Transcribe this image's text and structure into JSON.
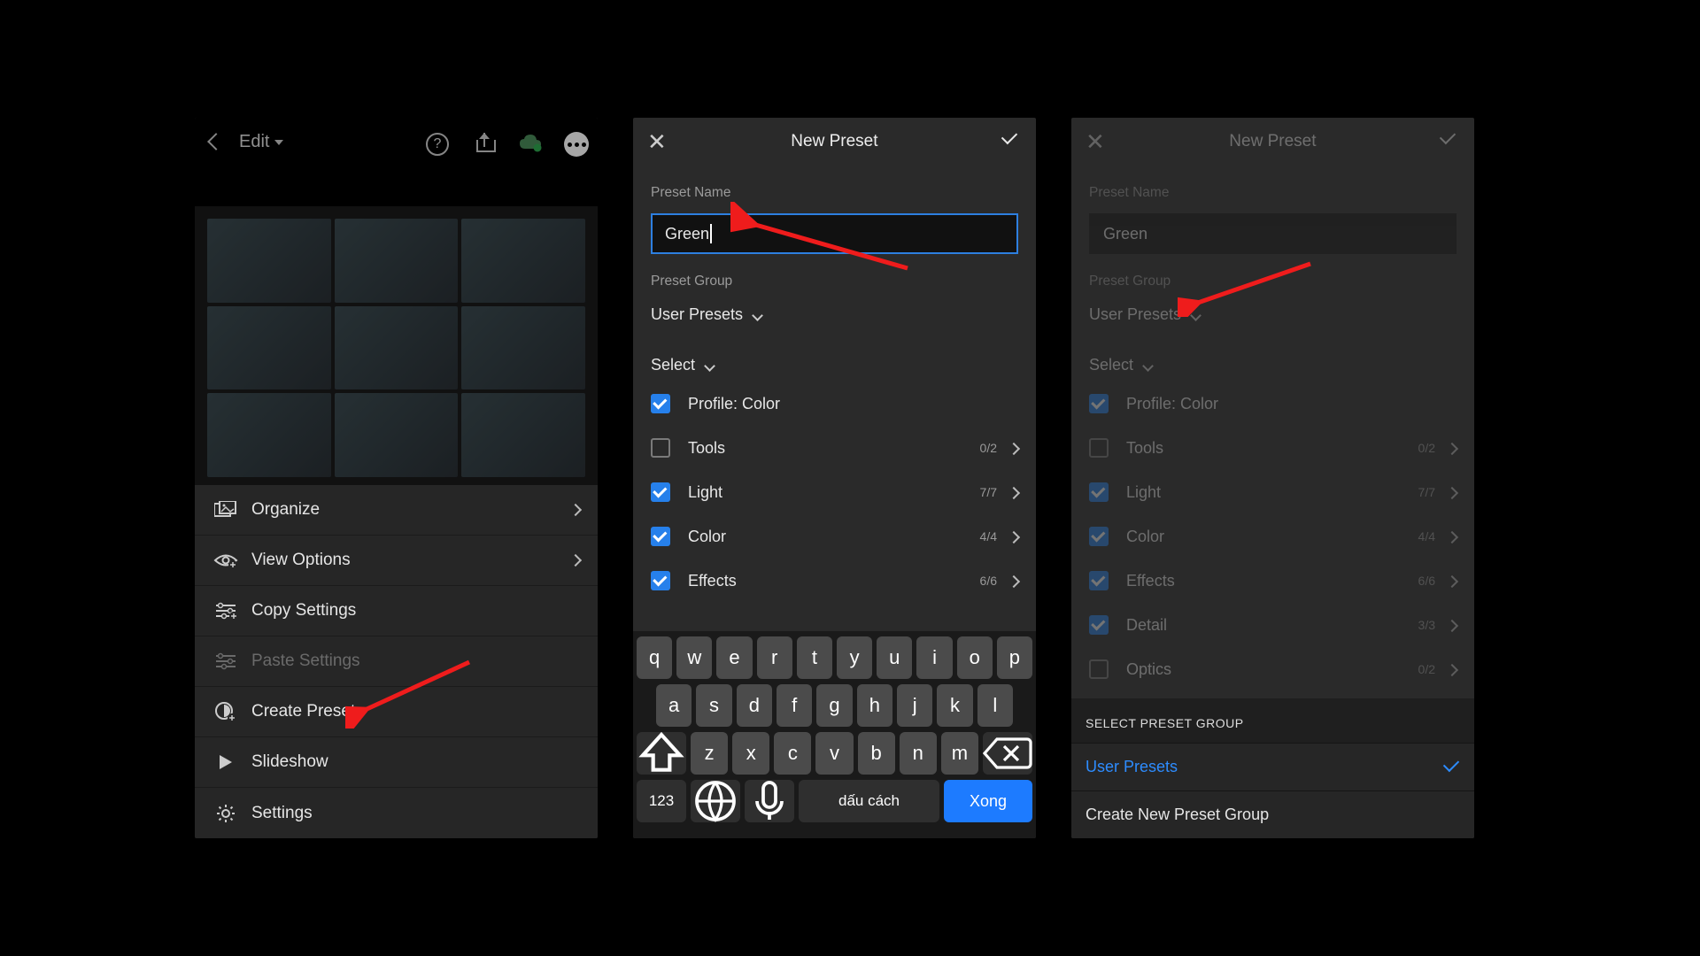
{
  "panel1": {
    "title": "Edit",
    "menu": {
      "organize": "Organize",
      "view_options": "View Options",
      "copy_settings": "Copy Settings",
      "paste_settings": "Paste Settings",
      "create_preset": "Create Preset",
      "slideshow": "Slideshow",
      "settings": "Settings"
    }
  },
  "panel2": {
    "title": "New Preset",
    "preset_name_label": "Preset Name",
    "preset_name_value": "Green",
    "preset_group_label": "Preset Group",
    "preset_group_value": "User Presets",
    "select_label": "Select",
    "options": [
      {
        "label": "Profile: Color",
        "checked": true,
        "count": ""
      },
      {
        "label": "Tools",
        "checked": false,
        "count": "0/2"
      },
      {
        "label": "Light",
        "checked": true,
        "count": "7/7"
      },
      {
        "label": "Color",
        "checked": true,
        "count": "4/4"
      },
      {
        "label": "Effects",
        "checked": true,
        "count": "6/6"
      }
    ],
    "keyboard": {
      "row1": [
        "q",
        "w",
        "e",
        "r",
        "t",
        "y",
        "u",
        "i",
        "o",
        "p"
      ],
      "row2": [
        "a",
        "s",
        "d",
        "f",
        "g",
        "h",
        "j",
        "k",
        "l"
      ],
      "row3": [
        "z",
        "x",
        "c",
        "v",
        "b",
        "n",
        "m"
      ],
      "numbers": "123",
      "space": "dấu cách",
      "done": "Xong"
    }
  },
  "panel3": {
    "title": "New Preset",
    "preset_name_label": "Preset Name",
    "preset_name_value": "Green",
    "preset_group_label": "Preset Group",
    "preset_group_value": "User Presets",
    "select_label": "Select",
    "options": [
      {
        "label": "Profile: Color",
        "checked": true,
        "count": ""
      },
      {
        "label": "Tools",
        "checked": false,
        "count": "0/2"
      },
      {
        "label": "Light",
        "checked": true,
        "count": "7/7"
      },
      {
        "label": "Color",
        "checked": true,
        "count": "4/4"
      },
      {
        "label": "Effects",
        "checked": true,
        "count": "6/6"
      },
      {
        "label": "Detail",
        "checked": true,
        "count": "3/3"
      },
      {
        "label": "Optics",
        "checked": false,
        "count": "0/2"
      }
    ],
    "select_group_header": "SELECT PRESET GROUP",
    "group_selected": "User Presets",
    "group_create": "Create New Preset Group"
  }
}
